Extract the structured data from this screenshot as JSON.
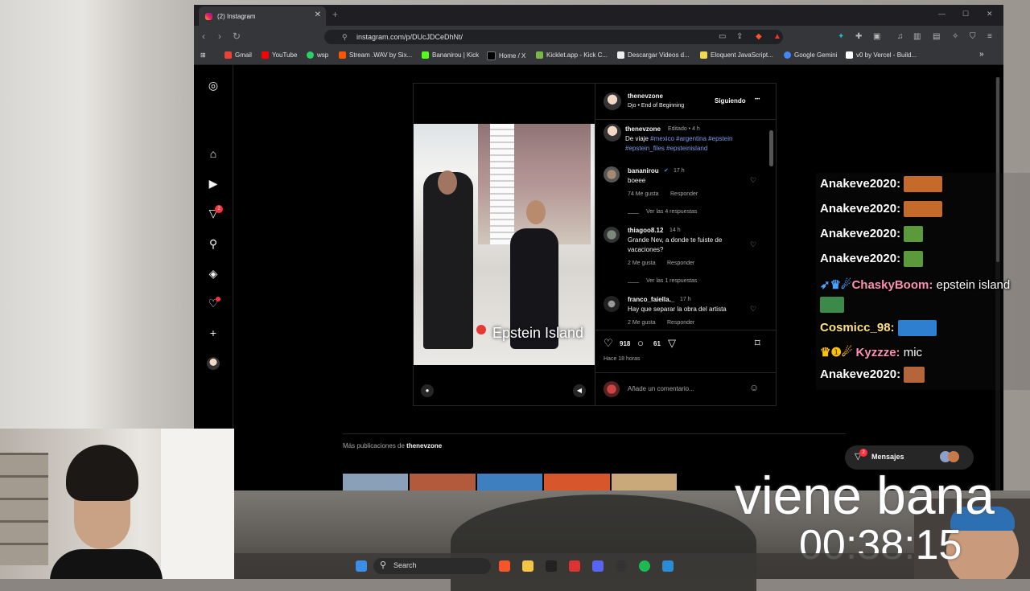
{
  "browser": {
    "tab_title": "(2) Instagram",
    "tab_close": "✕",
    "new_tab": "+",
    "url": "instagram.com/p/DUcJDCeDhNt/",
    "bookmarks": [
      "Gmail",
      "YouTube",
      "wsp",
      "Stream .WAV by Six...",
      "Bananirou | Kick",
      "Home / X",
      "Kicklet.app - Kick C...",
      "Descargar Videos d...",
      "Eloquent JavaScript...",
      "Google Gemini",
      "v0 by Vercel - Build..."
    ],
    "bookmarks_more": "»"
  },
  "sidebar": {
    "messages_badge": "2"
  },
  "post": {
    "author": "thenevzone",
    "audio": "Djo • End of Beginning",
    "follow_label": "Siguiendo",
    "more": "•••",
    "caption_author": "thenevzone",
    "caption_meta": "Editado • 4 h",
    "caption_text": "De viaje ",
    "caption_tags": "#mexico #argentina #epstein #epstein_files #epsteinisland",
    "video_caption": "Epstein Island",
    "likes": "918",
    "comments_count": "61",
    "time_ago": "Hace 18 horas",
    "add_comment_placeholder": "Añade un comentario...",
    "comments": [
      {
        "user": "bananirou",
        "verified": true,
        "time": "17 h",
        "text": "boeee",
        "likes": "74 Me gusta",
        "reply": "Responder",
        "view_replies": "Ver las 4 respuestas"
      },
      {
        "user": "thiagoo8.12",
        "verified": false,
        "time": "14 h",
        "text": "Grande Nev, a donde te fuiste de vacaciones?",
        "likes": "2 Me gusta",
        "reply": "Responder",
        "view_replies": "Ver las 1 respuestas"
      },
      {
        "user": "franco_faiella._",
        "verified": false,
        "time": "17 h",
        "text": "Hay que separar la obra del artista",
        "likes": "2 Me gusta",
        "reply": "Responder",
        "view_replies": ""
      }
    ]
  },
  "more_posts": {
    "label": "Más publicaciones de ",
    "author": "thenevzone"
  },
  "messages": {
    "label": "Mensajes",
    "badge": "2"
  },
  "chat": [
    {
      "user": "Anakeve2020:",
      "msg": "",
      "emote": "#c46a2a"
    },
    {
      "user": "Anakeve2020:",
      "msg": "",
      "emote": "#c46a2a"
    },
    {
      "user": "Anakeve2020:",
      "msg": "",
      "emote": "#5a9a3a"
    },
    {
      "user": "Anakeve2020:",
      "msg": "",
      "emote": "#5a9a3a"
    },
    {
      "user": "ChaskyBoom:",
      "msg": " epstein island",
      "emote": "#3c8a4a"
    },
    {
      "user": "Cosmicc_98:",
      "msg": "",
      "emote": "#2f7fd0"
    },
    {
      "user": "Kyzzze:",
      "msg": " mic",
      "emote": ""
    },
    {
      "user": "Anakeve2020:",
      "msg": "",
      "emote": "#b5653a"
    }
  ],
  "overlay": {
    "text": "viene bana",
    "timer": "00:38:15"
  },
  "taskbar": {
    "search": "Search"
  }
}
